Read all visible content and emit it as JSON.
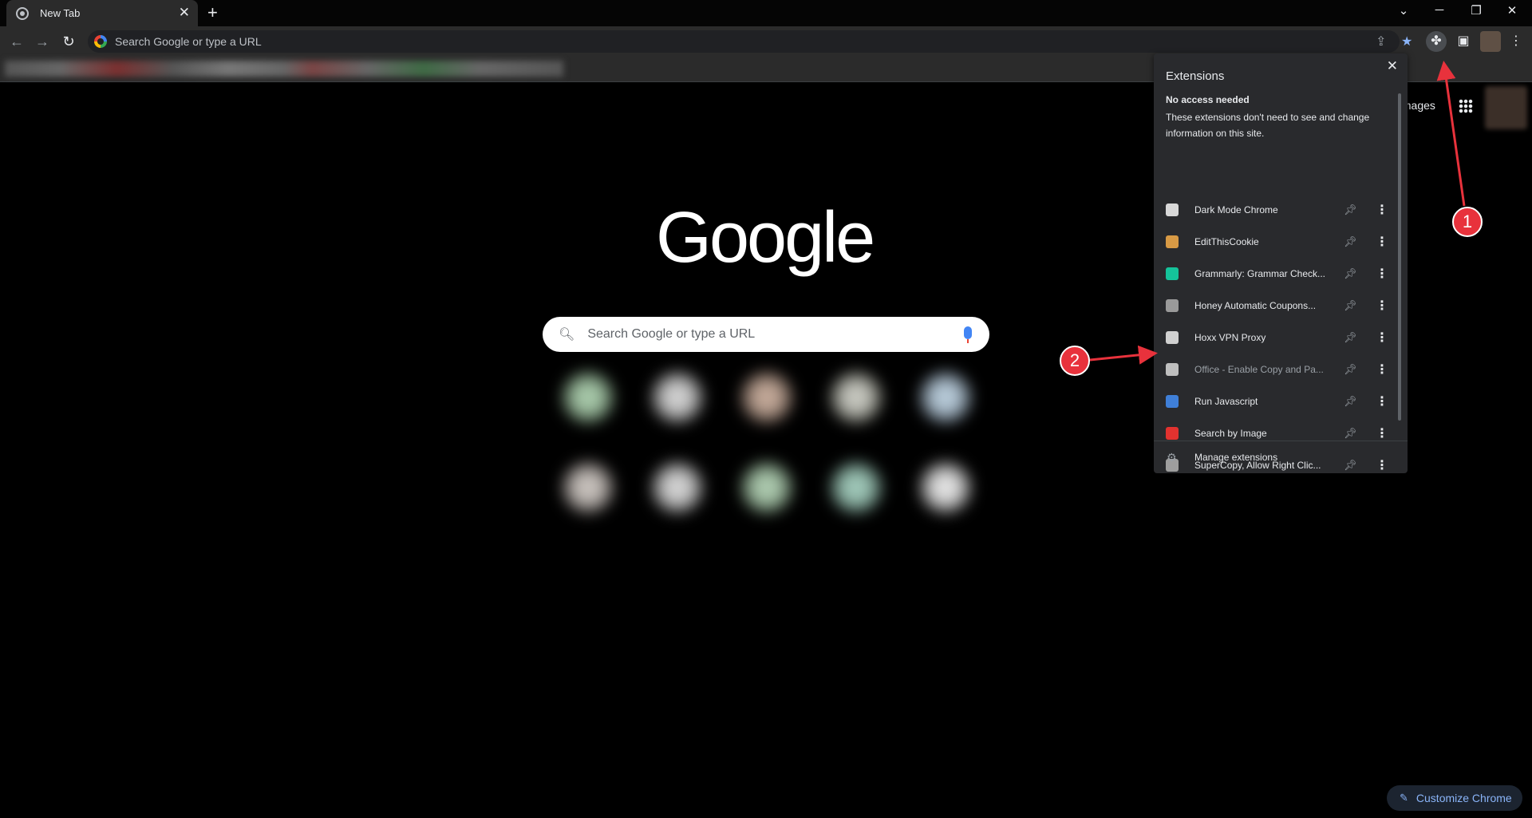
{
  "browser": {
    "tab_title": "New Tab",
    "tab_close": "✕",
    "new_tab": "+",
    "omnibox_placeholder": "Search Google or type a URL"
  },
  "window_controls": {
    "dropdown": "⌄",
    "minimize": "─",
    "restore": "❐",
    "close": "✕"
  },
  "newtab": {
    "logo": "Google",
    "search_placeholder": "Search Google or type a URL",
    "images_link": "Images",
    "customize_label": "Customize Chrome"
  },
  "extensions_panel": {
    "title": "Extensions",
    "close": "✕",
    "section_title": "No access needed",
    "section_desc": "These extensions don't need to see and change information on this site.",
    "items": [
      {
        "name": "Dark Mode Chrome",
        "icon": "dark-mode-icon",
        "color": "#d8d8d8"
      },
      {
        "name": "EditThisCookie",
        "icon": "cookie-icon",
        "color": "#d89a45"
      },
      {
        "name": "Grammarly: Grammar Check...",
        "icon": "grammarly-icon",
        "color": "#15c39a"
      },
      {
        "name": "Honey Automatic Coupons...",
        "icon": "honey-icon",
        "color": "#9a9a9a"
      },
      {
        "name": "Hoxx VPN Proxy",
        "icon": "hoxx-icon",
        "color": "#d0d0d0"
      },
      {
        "name": "Office - Enable Copy and Pa...",
        "icon": "office-icon",
        "color": "#bfbfbf"
      },
      {
        "name": "Run Javascript",
        "icon": "run-js-icon",
        "color": "#3f7fd8"
      },
      {
        "name": "Search by Image",
        "icon": "search-by-image-icon",
        "color": "#e2322f"
      },
      {
        "name": "SuperCopy, Allow Right Clic...",
        "icon": "supercopy-icon",
        "color": "#9e9e9e"
      }
    ],
    "manage_label": "Manage extensions"
  },
  "annotations": {
    "one": "1",
    "two": "2"
  },
  "colors": {
    "accent": "#8ab4f8",
    "annotation_red": "#e8323c"
  }
}
